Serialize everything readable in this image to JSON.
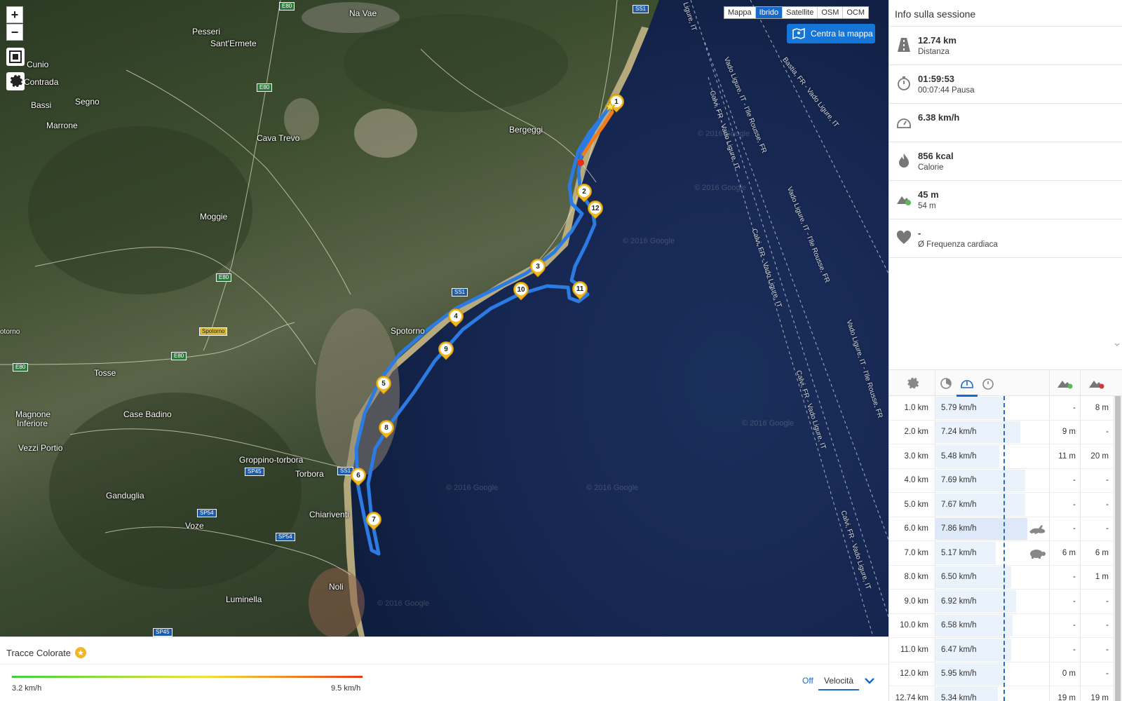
{
  "map": {
    "zoom_in": "+",
    "zoom_out": "−",
    "layers": [
      {
        "label": "Mappa",
        "active": false
      },
      {
        "label": "Ibrido",
        "active": true
      },
      {
        "label": "Satellite",
        "active": false
      },
      {
        "label": "OSM",
        "active": false
      },
      {
        "label": "OCM",
        "active": false
      }
    ],
    "center_button": "Centra la mappa",
    "places": [
      "Na Vae",
      "Pesseri",
      "Sant'Ermete",
      "Cunio",
      "Contrada",
      "Segno",
      "Bassi",
      "Marrone",
      "Cava Trevo",
      "Bergeggi",
      "Moggie",
      "Spotorno",
      "Tosse",
      "Magnone",
      "Inferiore",
      "Case Badino",
      "Vezzi Portio",
      "Groppino-torbora",
      "Torbora",
      "Ganduglia",
      "Voze",
      "Chiariventi",
      "Noli",
      "Luminella",
      "otorno"
    ],
    "roads": [
      "E80",
      "E80",
      "E80",
      "E80",
      "E80",
      "SS1",
      "SS1",
      "SS1",
      "SP45",
      "SP54",
      "SP54",
      "SP45",
      "Spotorno"
    ],
    "ferry_routes": [
      "Ligure, IT",
      "Vado Ligure, IT - l'Ile Rousse, FR",
      "Bastia, FR - Vado Ligure, IT",
      "Calvi, FR - Vado Ligure, IT",
      "Vado Ligure, IT - l'Ile Rousse, FR",
      "Calvi, FR - Vado Ligure, IT",
      "Vado Ligure, IT - l'Ile Rousse, FR",
      "Calvi, FR - Vado Ligure, IT",
      "Calvi, FR - Vado Ligure, IT"
    ],
    "watermarks": [
      "© 2016 Google",
      "© 2016 Google",
      "© 2016 Google",
      "© 2016 Google",
      "© 2016 Google",
      "© 2016 Google",
      "© 2016 Google"
    ],
    "markers": [
      "1",
      "2",
      "12",
      "3",
      "10",
      "11",
      "4",
      "9",
      "5",
      "8",
      "6",
      "7"
    ],
    "route_color": "#2b7be3"
  },
  "legend": {
    "title": "Tracce Colorate",
    "star": "★",
    "min": "3.2 km/h",
    "max": "9.5 km/h",
    "off": "Off",
    "selected": "Velocità"
  },
  "panel": {
    "title": "Info sulla sessione",
    "stats": [
      {
        "value": "12.74 km",
        "label": "Distanza",
        "icon": "road-icon"
      },
      {
        "value": "01:59:53",
        "label": "00:07:44 Pausa",
        "icon": "stopwatch-icon"
      },
      {
        "value": "6.38 km/h",
        "label": "",
        "icon": "speedometer-icon"
      },
      {
        "value": "856 kcal",
        "label": "Calorie",
        "icon": "flame-icon"
      },
      {
        "value": "45 m",
        "label": "54 m",
        "icon": "elevation-icon"
      },
      {
        "value": "-",
        "label": "Ø Frequenza cardiaca",
        "icon": "heart-icon"
      }
    ]
  },
  "splits": {
    "rows": [
      {
        "km": "1.0 km",
        "speed": "5.79 km/h",
        "speed_value": 5.79,
        "up": "-",
        "down": "8 m",
        "badge": ""
      },
      {
        "km": "2.0 km",
        "speed": "7.24 km/h",
        "speed_value": 7.24,
        "up": "9 m",
        "down": "-",
        "badge": ""
      },
      {
        "km": "3.0 km",
        "speed": "5.48 km/h",
        "speed_value": 5.48,
        "up": "11 m",
        "down": "20 m",
        "badge": ""
      },
      {
        "km": "4.0 km",
        "speed": "7.69 km/h",
        "speed_value": 7.69,
        "up": "-",
        "down": "-",
        "badge": ""
      },
      {
        "km": "5.0 km",
        "speed": "7.67 km/h",
        "speed_value": 7.67,
        "up": "-",
        "down": "-",
        "badge": ""
      },
      {
        "km": "6.0 km",
        "speed": "7.86 km/h",
        "speed_value": 7.86,
        "up": "-",
        "down": "-",
        "badge": "hare"
      },
      {
        "km": "7.0 km",
        "speed": "5.17 km/h",
        "speed_value": 5.17,
        "up": "6 m",
        "down": "6 m",
        "badge": "tortoise"
      },
      {
        "km": "8.0 km",
        "speed": "6.50 km/h",
        "speed_value": 6.5,
        "up": "-",
        "down": "1 m",
        "badge": ""
      },
      {
        "km": "9.0 km",
        "speed": "6.92 km/h",
        "speed_value": 6.92,
        "up": "-",
        "down": "-",
        "badge": ""
      },
      {
        "km": "10.0 km",
        "speed": "6.58 km/h",
        "speed_value": 6.58,
        "up": "-",
        "down": "-",
        "badge": ""
      },
      {
        "km": "11.0 km",
        "speed": "6.47 km/h",
        "speed_value": 6.47,
        "up": "-",
        "down": "-",
        "badge": ""
      },
      {
        "km": "12.0 km",
        "speed": "5.95 km/h",
        "speed_value": 5.95,
        "up": "0 m",
        "down": "-",
        "badge": ""
      },
      {
        "km": "12.74 km",
        "speed": "5.34 km/h",
        "speed_value": 5.34,
        "up": "19 m",
        "down": "19 m",
        "badge": ""
      }
    ]
  }
}
